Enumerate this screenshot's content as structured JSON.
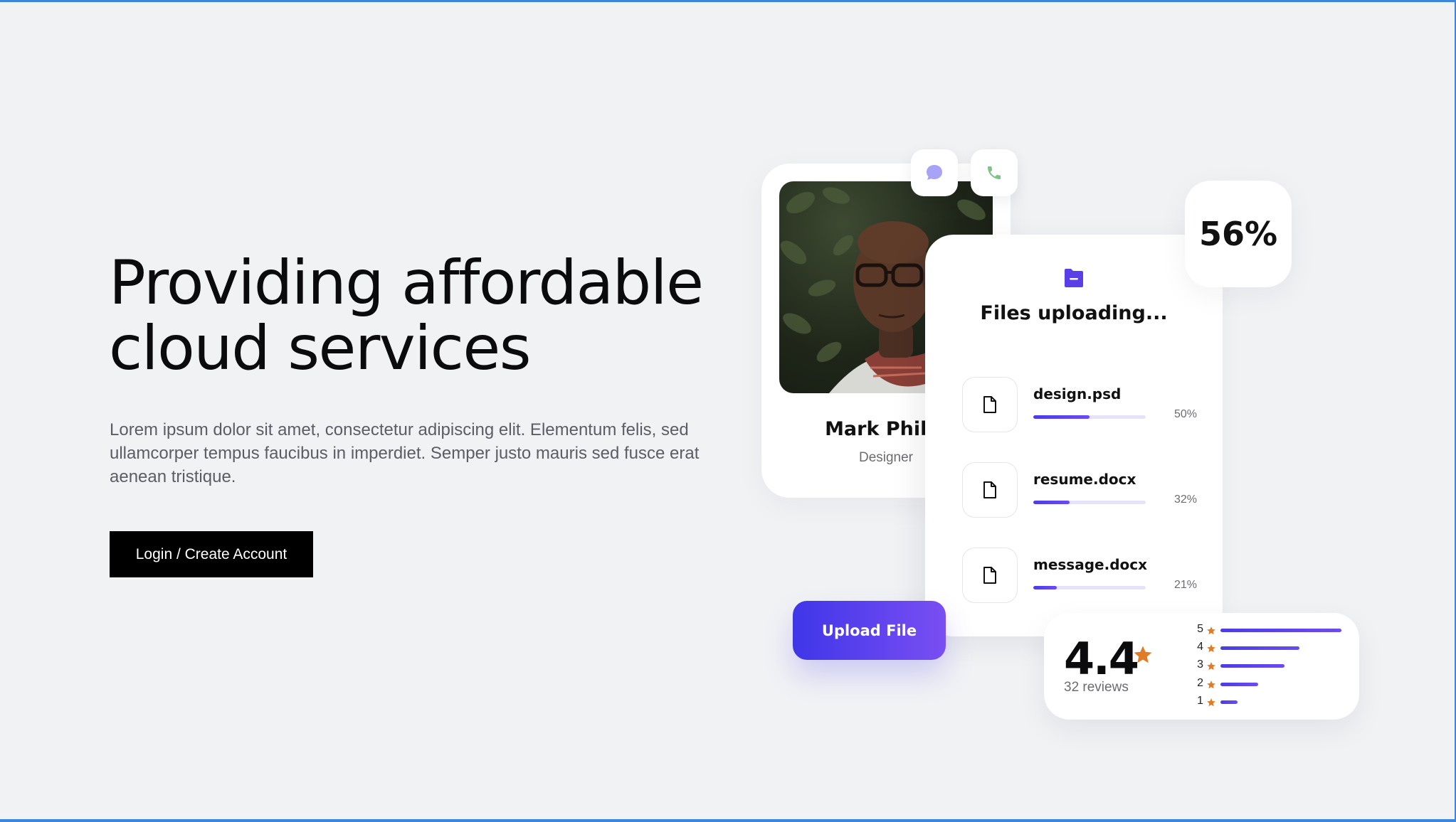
{
  "hero": {
    "title_line1": "Providing affordable",
    "title_line2": "cloud services",
    "description": "Lorem ipsum dolor sit amet, consectetur adipiscing elit. Elementum felis, sed ullamcorper tempus faucibus in imperdiet. Semper justo mauris sed fusce erat aenean tristique.",
    "cta_label": "Login / Create Account"
  },
  "profile": {
    "name": "Mark Philip",
    "role": "Designer",
    "chat_icon": "chat-bubble-icon",
    "phone_icon": "phone-icon"
  },
  "files": {
    "title": "Files uploading...",
    "items": [
      {
        "name": "design.psd",
        "progress": 50,
        "progress_label": "50%"
      },
      {
        "name": "resume.docx",
        "progress": 32,
        "progress_label": "32%"
      },
      {
        "name": "message.docx",
        "progress": 21,
        "progress_label": "21%"
      }
    ]
  },
  "overall_progress": "56%",
  "upload_label": "Upload File",
  "rating": {
    "score": "4.4",
    "reviews": "32 reviews",
    "distribution": [
      {
        "stars": "5",
        "fraction": 1.0
      },
      {
        "stars": "4",
        "fraction": 0.65
      },
      {
        "stars": "3",
        "fraction": 0.53
      },
      {
        "stars": "2",
        "fraction": 0.31
      },
      {
        "stars": "1",
        "fraction": 0.14
      }
    ]
  },
  "colors": {
    "accent": "#4a3ce6",
    "accent_light": "#7a4ef3",
    "star": "#e07b27",
    "chat_icon": "#a9a3f5",
    "phone_icon": "#7dc387",
    "frame": "#3d86dd"
  }
}
